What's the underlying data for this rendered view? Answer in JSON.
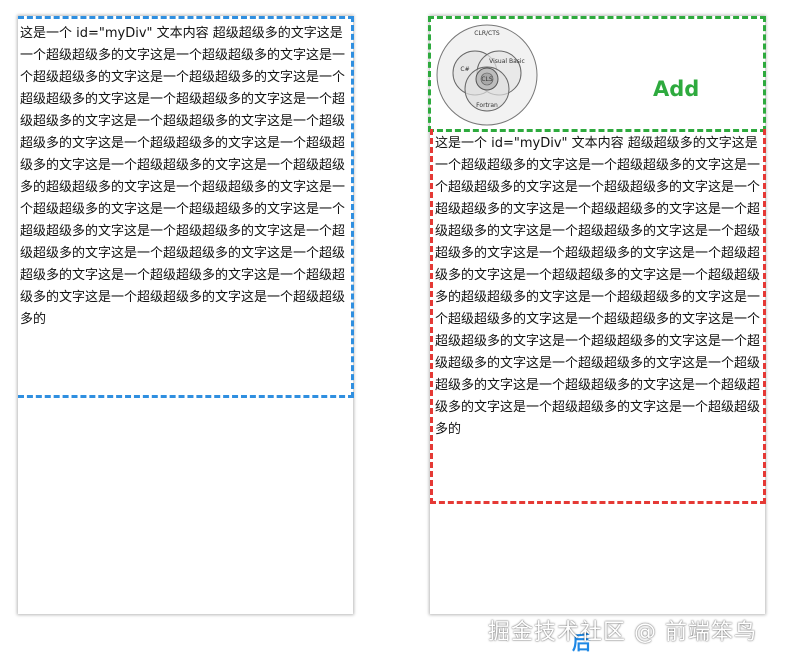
{
  "left_panel": {
    "text": "这是一个 id=\"myDiv\" 文本内容 超级超级多的文字这是一个超级超级多的文字这是一个超级超级多的文字这是一个超级超级多的文字这是一个超级超级多的文字这是一个超级超级多的文字这是一个超级超级多的文字这是一个超级超级多的文字这是一个超级超级多的文字这是一个超级超级多的文字这是一个超级超级多的文字这是一个超级超级多的文字这是一个超级超级多的文字这是一个超级超级多的超级超级多的文字这是一个超级超级多的文字这是一个超级超级多的文字这是一个超级超级多的文字这是一个超级超级多的文字这是一个超级超级多的文字这是一个超级超级多的文字这是一个超级超级多的文字这是一个超级超级多的文字这是一个超级超级多的文字这是一个超级超级多的文字这是一个超级超级多的文字这是一个超级超级多的",
    "border_color": "#2f8fe0"
  },
  "right_panel": {
    "add_label": "Add",
    "add_border_color": "#2eaa3e",
    "text": "这是一个 id=\"myDiv\" 文本内容 超级超级多的文字这是一个超级超级多的文字这是一个超级超级多的文字这是一个超级超级多的文字这是一个超级超级多的文字这是一个超级超级多的文字这是一个超级超级多的文字这是一个超级超级多的文字这是一个超级超级多的文字这是一个超级超级多的文字这是一个超级超级多的文字这是一个超级超级多的文字这是一个超级超级多的文字这是一个超级超级多的超级超级多的文字这是一个超级超级多的文字这是一个超级超级多的文字这是一个超级超级多的文字这是一个超级超级多的文字这是一个超级超级多的文字这是一个超级超级多的文字这是一个超级超级多的文字这是一个超级超级多的文字这是一个超级超级多的文字这是一个超级超级多的文字这是一个超级超级多的文字这是一个超级超级多的",
    "border_color": "#e53935",
    "logo": {
      "icon": "clr-cts-venn-diagram-icon",
      "labels": {
        "outer": "CLR/CTS",
        "left": "C#",
        "right": "Visual Basic",
        "center": "CLS",
        "bottom": "Fortran"
      }
    }
  },
  "after_label": "后",
  "watermark": "掘金技术社区 @ 前端笨鸟"
}
